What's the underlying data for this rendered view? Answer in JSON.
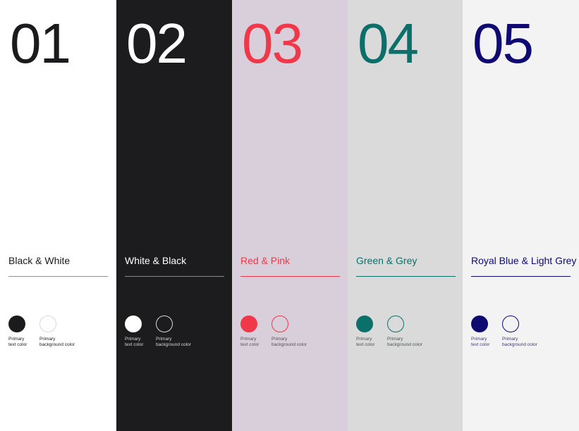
{
  "palettes": [
    {
      "number": "01",
      "name": "Black & White",
      "text_color": "#1b1a1c",
      "background_color": "#ffffff",
      "rule_color": "#8e8e8e",
      "label_color": "#1b1a1c",
      "swatch_primary_text": "#1b1a1c",
      "swatch_primary_bg": "#ffffff",
      "swatch_bg_border": "#d9d9d9",
      "label_text_line1": "Primary",
      "label_text_line2": "text color",
      "label_bg_line1": "Primary",
      "label_bg_line2": "background color"
    },
    {
      "number": "02",
      "name": "White & Black",
      "text_color": "#ffffff",
      "background_color": "#1c1b1e",
      "rule_color": "#8a8a8a",
      "label_color": "#d9d9d9",
      "swatch_primary_text": "#ffffff",
      "swatch_primary_bg": "#1c1b1e",
      "swatch_bg_border": "#d9d9d9",
      "label_text_line1": "Primary",
      "label_text_line2": "text color",
      "label_bg_line1": "Primary",
      "label_bg_line2": "background color"
    },
    {
      "number": "03",
      "name": "Red & Pink",
      "text_color": "#f0384a",
      "background_color": "#d8cfdb",
      "rule_color": "#f0384a",
      "label_color": "#5a4b5c",
      "swatch_primary_text": "#f0384a",
      "swatch_primary_bg": "#d8cfdb",
      "swatch_bg_border": "#f0384a",
      "label_text_line1": "Primary",
      "label_text_line2": "text color",
      "label_bg_line1": "Primary",
      "label_bg_line2": "background color"
    },
    {
      "number": "04",
      "name": "Green & Grey",
      "text_color": "#0b6f6a",
      "background_color": "#dadada",
      "rule_color": "#0b6f6a",
      "label_color": "#4d5452",
      "swatch_primary_text": "#0b6f6a",
      "swatch_primary_bg": "#dadada",
      "swatch_bg_border": "#0b6f6a",
      "label_text_line1": "Primary",
      "label_text_line2": "text color",
      "label_bg_line1": "Primary",
      "label_bg_line2": "background color"
    },
    {
      "number": "05",
      "name": "Royal Blue & Light Grey",
      "text_color": "#0e0a72",
      "background_color": "#f3f3f3",
      "rule_color": "#0e0a72",
      "label_color": "#3e3c6e",
      "swatch_primary_text": "#0e0a72",
      "swatch_primary_bg": "#f3f3f3",
      "swatch_bg_border": "#0e0a72",
      "label_text_line1": "Primary",
      "label_text_line2": "text color",
      "label_bg_line1": "Primary",
      "label_bg_line2": "background color"
    }
  ]
}
